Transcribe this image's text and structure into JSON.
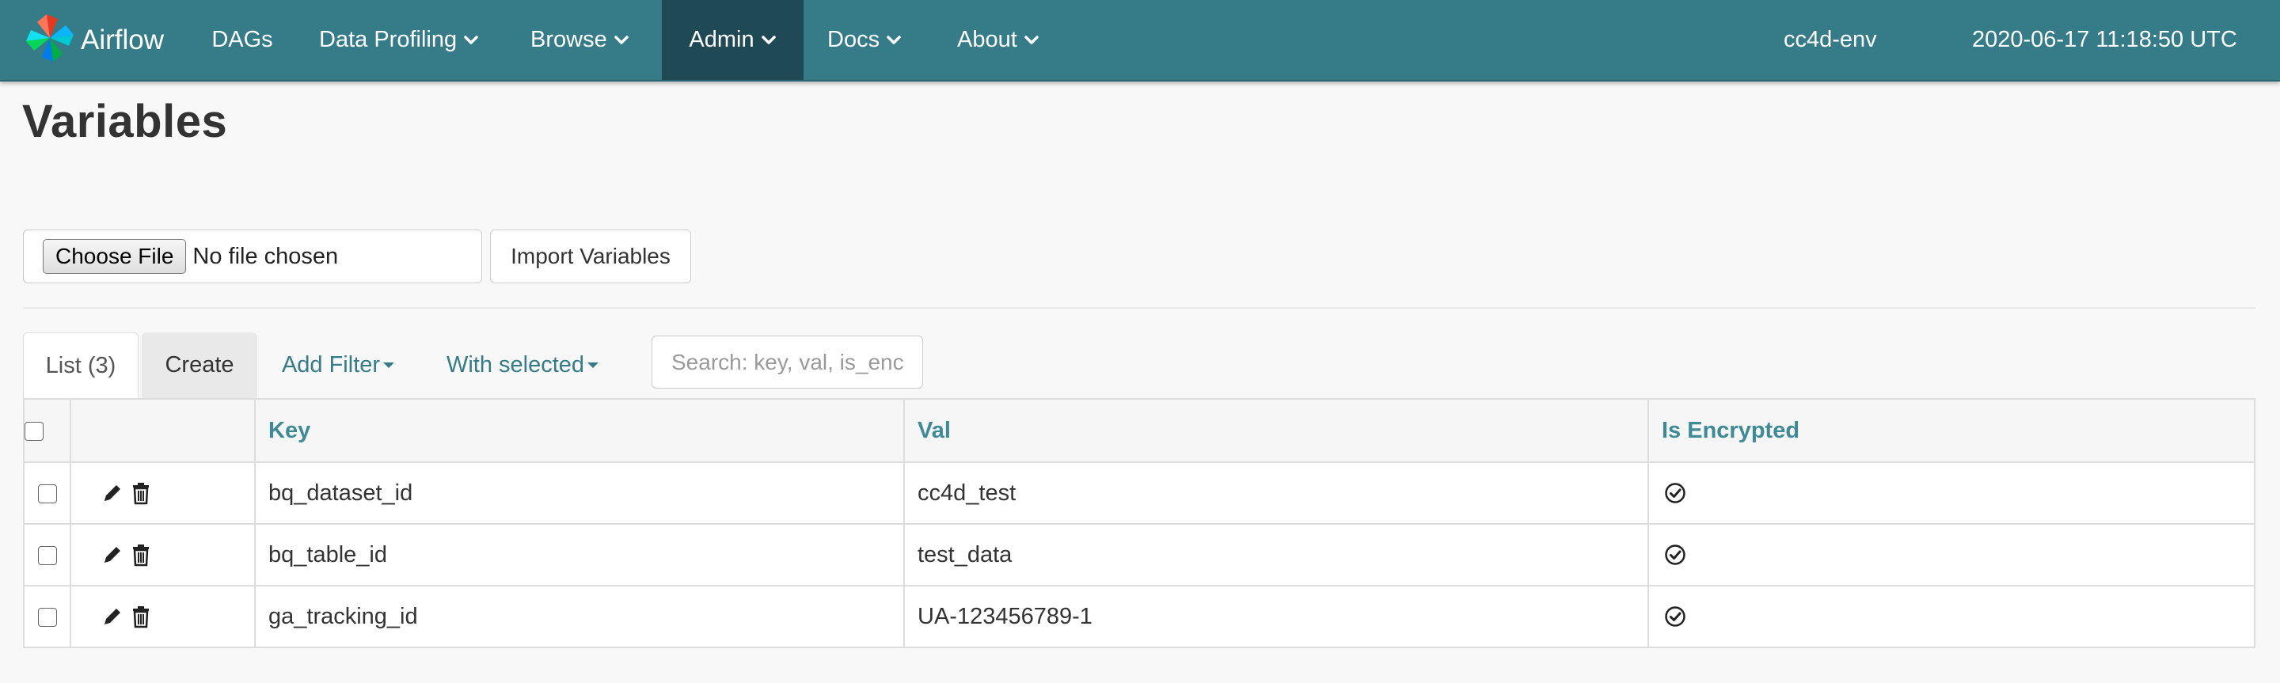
{
  "navbar": {
    "brand": "Airflow",
    "items": [
      {
        "label": "DAGs",
        "dropdown": false
      },
      {
        "label": "Data Profiling",
        "dropdown": true
      },
      {
        "label": "Browse",
        "dropdown": true
      },
      {
        "label": "Admin",
        "dropdown": true,
        "active": true
      },
      {
        "label": "Docs",
        "dropdown": true
      },
      {
        "label": "About",
        "dropdown": true
      }
    ],
    "env": "cc4d-env",
    "datetime": "2020-06-17 11:18:50 UTC"
  },
  "page": {
    "title": "Variables"
  },
  "import": {
    "choose_file_label": "Choose File",
    "no_file_text": "No file chosen",
    "import_button_label": "Import Variables"
  },
  "tabs": {
    "list_label": "List (3)",
    "create_label": "Create",
    "add_filter_label": "Add Filter",
    "with_selected_label": "With selected"
  },
  "search": {
    "placeholder": "Search: key, val, is_enc"
  },
  "table": {
    "columns": [
      "Key",
      "Val",
      "Is Encrypted"
    ],
    "rows": [
      {
        "key": "bq_dataset_id",
        "val": "cc4d_test",
        "is_encrypted": true
      },
      {
        "key": "bq_table_id",
        "val": "test_data",
        "is_encrypted": true
      },
      {
        "key": "ga_tracking_id",
        "val": "UA-123456789-1",
        "is_encrypted": true
      }
    ]
  },
  "colors": {
    "navbar": "#357b88",
    "navbar_active": "#1f4a55",
    "link": "#357b88",
    "header_text": "#3e8a97"
  },
  "icons": {
    "brand": "airflow-pinwheel-icon",
    "dropdown": "chevron-down-icon",
    "edit": "pencil-icon",
    "delete": "trash-icon",
    "encrypted": "check-circle-icon"
  }
}
